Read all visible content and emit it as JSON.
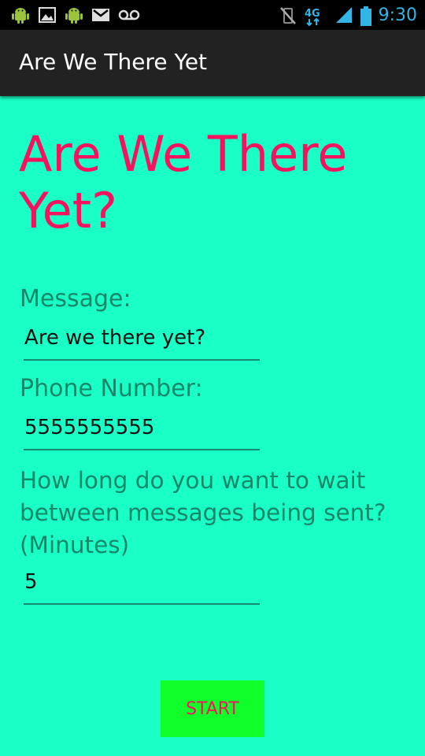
{
  "status_bar": {
    "time": "9:30",
    "network": "4G",
    "icons": [
      "android-icon",
      "image-icon",
      "android-icon",
      "gmail-icon",
      "voicemail-icon",
      "vibrate-mute-icon",
      "network-4g-icon",
      "signal-icon",
      "battery-icon"
    ]
  },
  "action_bar": {
    "title": "Are We There Yet"
  },
  "main": {
    "heading": "Are We There Yet?",
    "message_label": "Message:",
    "message_value": "Are we there yet?",
    "phone_label": "Phone Number:",
    "phone_value": "5555555555",
    "interval_label": "How long do you want to wait between messages being sent? (Minutes)",
    "interval_value": "5",
    "start_label": "START"
  },
  "colors": {
    "background": "#1affc6",
    "heading": "#f7125e",
    "label": "#17876a",
    "button_bg": "#10ff2a",
    "button_text": "#f7125e",
    "action_bar": "#222222",
    "status_accent": "#33b5e5",
    "notification_icon": "#9bc43a"
  }
}
